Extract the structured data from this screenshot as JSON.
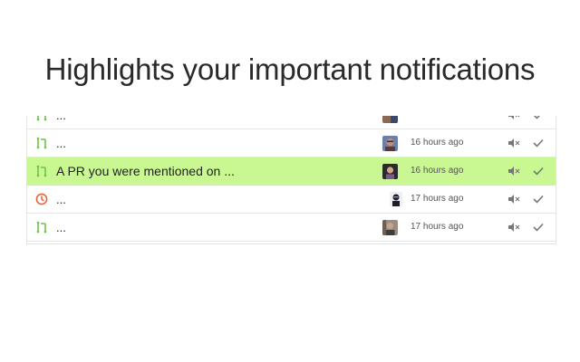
{
  "headline": "Highlights your important notifications",
  "colors": {
    "highlight": "#c9f792",
    "pr_icon": "#6cc644",
    "issue_icon": "#e8663c"
  },
  "notifications": [
    {
      "title": "...",
      "type_icon": "pull-request-icon",
      "time": "",
      "highlighted": false
    },
    {
      "title": "...",
      "type_icon": "pull-request-icon",
      "time": "16 hours ago",
      "highlighted": false
    },
    {
      "title": "A PR you were mentioned on ...",
      "type_icon": "pull-request-icon",
      "time": "16 hours ago",
      "highlighted": true
    },
    {
      "title": "...",
      "type_icon": "issue-icon",
      "time": "17 hours ago",
      "highlighted": false
    },
    {
      "title": "...",
      "type_icon": "pull-request-icon",
      "time": "17 hours ago",
      "highlighted": false
    }
  ]
}
